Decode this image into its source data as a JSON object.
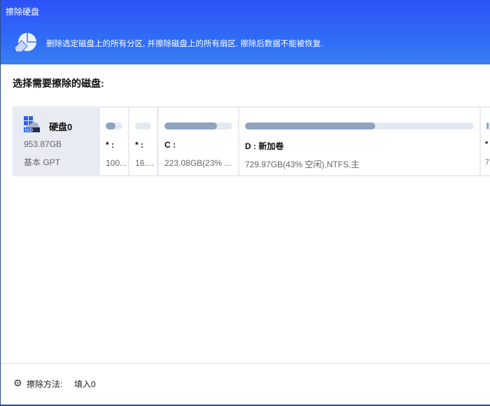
{
  "window": {
    "title": "擦除硬盘"
  },
  "banner": {
    "description": "删除选定磁盘上的所有分区, 并擦除磁盘上的所有扇区. 擦除后数据不能被恢复."
  },
  "section_title": "选择需要擦除的磁盘:",
  "disk": {
    "name": "硬盘0",
    "size": "953.87GB",
    "type": "基本 GPT",
    "badge": "SSD"
  },
  "partitions": [
    {
      "label": "* :",
      "info": "100...",
      "used_fraction": 0.6
    },
    {
      "label": "* :",
      "info": "16....",
      "used_fraction": 0.0
    },
    {
      "label": "C :",
      "info": "223.08GB(23% ...",
      "used_fraction": 0.77
    },
    {
      "label": "D : 新加卷",
      "info": "729.97GB(43% 空闲),NTFS,主",
      "used_fraction": 0.57
    },
    {
      "label": "*",
      "info": "7",
      "used_fraction": 0.6
    }
  ],
  "footer": {
    "method_label": "擦除方法:",
    "method_value": "填入0"
  }
}
